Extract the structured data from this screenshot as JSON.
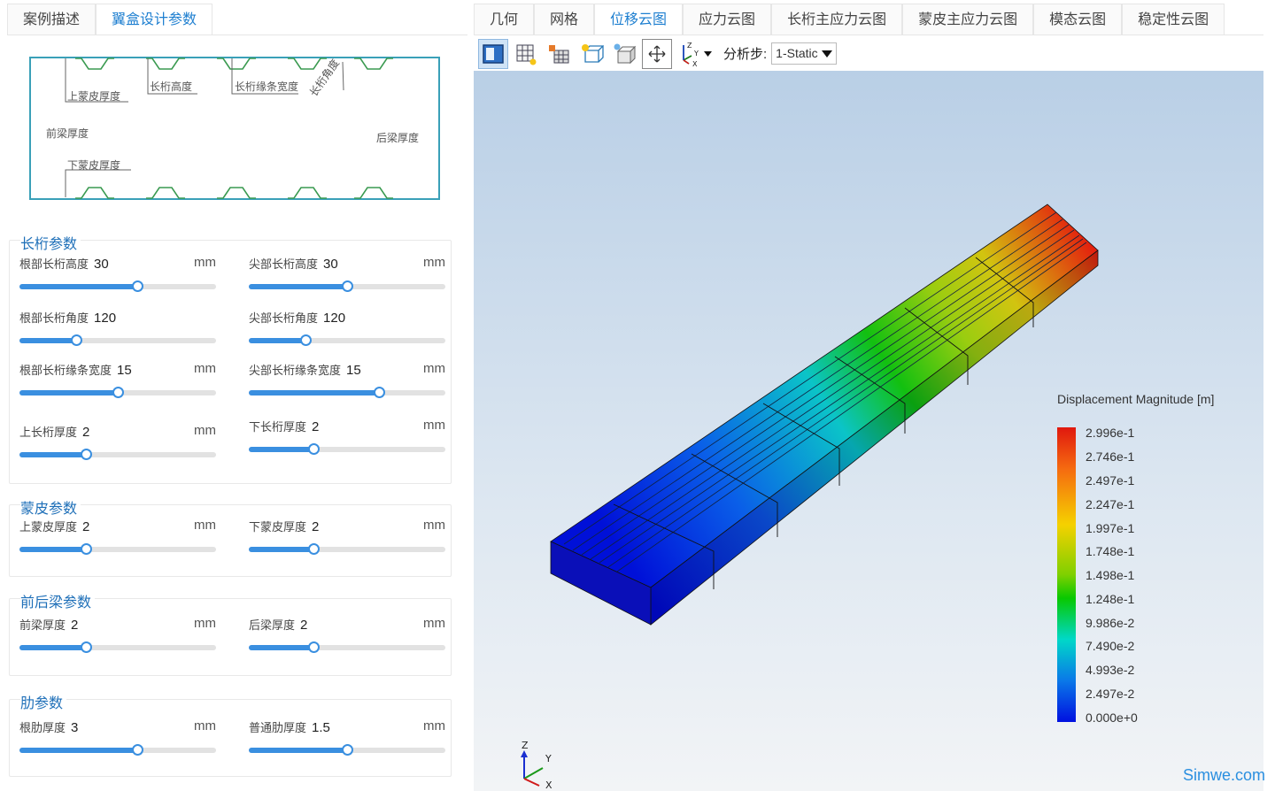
{
  "left_tabs": [
    "案例描述",
    "翼盒设计参数"
  ],
  "right_tabs": [
    "几何",
    "网格",
    "位移云图",
    "应力云图",
    "长桁主应力云图",
    "蒙皮主应力云图",
    "模态云图",
    "稳定性云图"
  ],
  "diagram_labels": {
    "upper_skin": "上蒙皮厚度",
    "stringer_height": "长桁高度",
    "flange_width": "长桁缘条宽度",
    "stringer_angle": "长桁角度",
    "front_spar": "前梁厚度",
    "rear_spar": "后梁厚度",
    "lower_skin": "下蒙皮厚度"
  },
  "sections": [
    {
      "title": "长桁参数",
      "params": [
        {
          "label": "根部长桁高度",
          "value": "30",
          "unit": "mm",
          "level": 0.6
        },
        {
          "label": "尖部长桁高度",
          "value": "30",
          "unit": "mm",
          "level": 0.5
        },
        {
          "label": "根部长桁角度",
          "value": "120",
          "unit": "",
          "level": 0.29
        },
        {
          "label": "尖部长桁角度",
          "value": "120",
          "unit": "",
          "level": 0.29
        },
        {
          "label": "根部长桁缘条宽度",
          "value": "15",
          "unit": "mm",
          "level": 0.5
        },
        {
          "label": "尖部长桁缘条宽度",
          "value": "15",
          "unit": "mm",
          "level": 0.66
        },
        {
          "label": "上长桁厚度",
          "value": "2",
          "unit": "mm",
          "level": 0.34
        },
        {
          "label": "下长桁厚度",
          "value": "2",
          "unit": "mm",
          "level": 0.33
        }
      ]
    },
    {
      "title": "蒙皮参数",
      "params": [
        {
          "label": "上蒙皮厚度",
          "value": "2",
          "unit": "mm",
          "level": 0.34
        },
        {
          "label": "下蒙皮厚度",
          "value": "2",
          "unit": "mm",
          "level": 0.33
        }
      ]
    },
    {
      "title": "前后梁参数",
      "params": [
        {
          "label": "前梁厚度",
          "value": "2",
          "unit": "mm",
          "level": 0.34
        },
        {
          "label": "后梁厚度",
          "value": "2",
          "unit": "mm",
          "level": 0.33
        }
      ]
    },
    {
      "title": "肋参数",
      "params": [
        {
          "label": "根肋厚度",
          "value": "3",
          "unit": "mm",
          "level": 0.6
        },
        {
          "label": "普通肋厚度",
          "value": "1.5",
          "unit": "mm",
          "level": 0.5
        }
      ]
    }
  ],
  "toolbar": {
    "step_label": "分析步:",
    "step_value": "1-Static",
    "icons": [
      "solid-view-icon",
      "mesh-view-icon",
      "mesh-light-icon",
      "wireframe-light-icon",
      "hidden-line-icon",
      "fit-view-icon",
      "axis-triad-icon"
    ]
  },
  "legend": {
    "title": "Displacement Magnitude [m]",
    "ticks": [
      "2.996e-1",
      "2.746e-1",
      "2.497e-1",
      "2.247e-1",
      "1.997e-1",
      "1.748e-1",
      "1.498e-1",
      "1.248e-1",
      "9.986e-2",
      "7.490e-2",
      "4.993e-2",
      "2.497e-2",
      "0.000e+0"
    ]
  },
  "axes": {
    "z": "Z",
    "y": "Y",
    "x": "X"
  },
  "watermark": "Simwe.com",
  "colors": {
    "accent": "#1e7fd0",
    "slider": "#3a8fe0"
  }
}
